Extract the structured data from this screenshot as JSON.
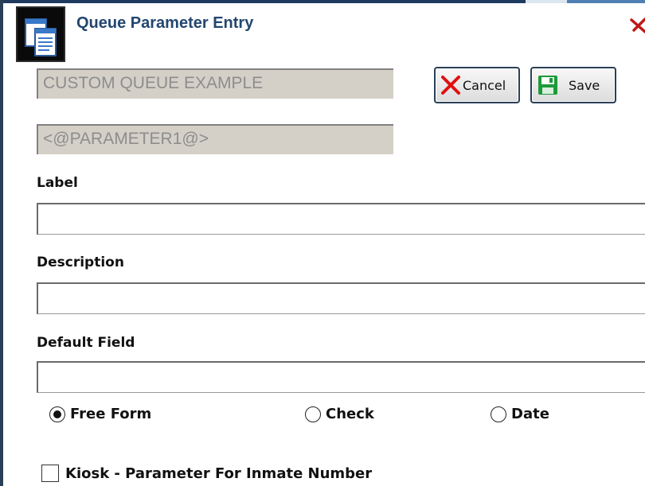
{
  "dialog": {
    "title": "Queue Parameter Entry",
    "icon": "copy-documents-icon"
  },
  "readonly_fields": {
    "queue_name": "CUSTOM QUEUE EXAMPLE",
    "parameter_token": "<@PARAMETER1@>"
  },
  "buttons": {
    "cancel_label": "Cancel",
    "cancel_icon": "red-x-icon",
    "save_label": "Save",
    "save_icon": "floppy-disk-icon"
  },
  "fields": {
    "label": {
      "label": "Label",
      "value": ""
    },
    "description": {
      "label": "Description",
      "value": ""
    },
    "default_field": {
      "label": "Default Field",
      "value": ""
    }
  },
  "radio_options": [
    {
      "label": "Free Form",
      "selected": true
    },
    {
      "label": "Check",
      "selected": false
    },
    {
      "label": "Date",
      "selected": false
    }
  ],
  "checkbox": {
    "label": "Kiosk - Parameter For Inmate Number",
    "checked": false
  },
  "colors": {
    "title_blue": "#23466f",
    "frame_navy": "#2a3f57",
    "readonly_gray": "#d4d0c8",
    "cancel_red": "#e01010",
    "save_green": "#1d9a3a"
  }
}
